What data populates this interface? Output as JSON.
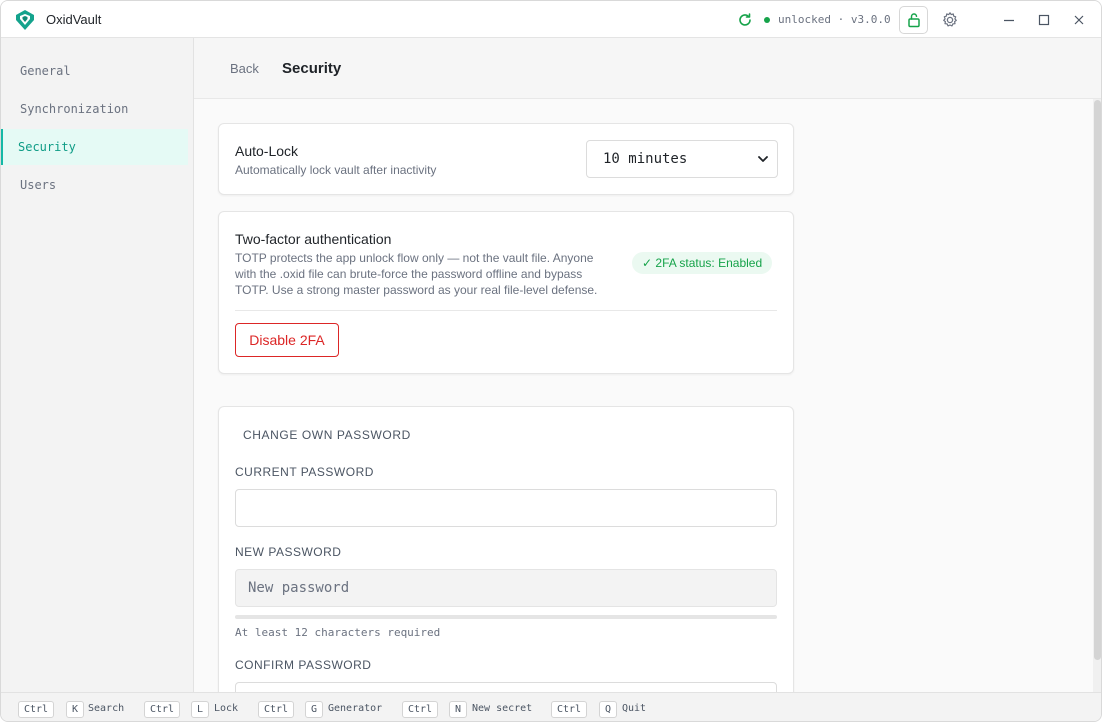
{
  "app": {
    "title": "OxidVault",
    "status": "unlocked · v3.0.0",
    "colors": {
      "accent": "#14b8a6",
      "success": "#16a34a",
      "danger": "#dc2626"
    }
  },
  "sidebar": {
    "items": [
      {
        "label": "General"
      },
      {
        "label": "Synchronization"
      },
      {
        "label": "Security"
      },
      {
        "label": "Users"
      }
    ]
  },
  "header": {
    "back": "Back",
    "title": "Security"
  },
  "autolock": {
    "title": "Auto-Lock",
    "subtitle": "Automatically lock vault after inactivity",
    "selected": "10 minutes"
  },
  "twofa": {
    "title": "Two-factor authentication",
    "description": "TOTP protects the app unlock flow only — not the vault file. Anyone with the .oxid file can brute-force the password offline and bypass TOTP. Use a strong master password as your real file-level defense.",
    "badge": "✓ 2FA status: Enabled",
    "disable_label": "Disable 2FA"
  },
  "password": {
    "heading": "CHANGE OWN PASSWORD",
    "current_label": "CURRENT PASSWORD",
    "current_value": "",
    "new_label": "NEW PASSWORD",
    "new_placeholder": "New password",
    "hint": "At least 12 characters required",
    "confirm_label": "CONFIRM PASSWORD"
  },
  "footer": {
    "shortcuts": [
      {
        "key1": "Ctrl",
        "key2": "K",
        "label": "Search"
      },
      {
        "key1": "Ctrl",
        "key2": "L",
        "label": "Lock"
      },
      {
        "key1": "Ctrl",
        "key2": "G",
        "label": "Generator"
      },
      {
        "key1": "Ctrl",
        "key2": "N",
        "label": "New secret"
      },
      {
        "key1": "Ctrl",
        "key2": "Q",
        "label": "Quit"
      }
    ]
  }
}
